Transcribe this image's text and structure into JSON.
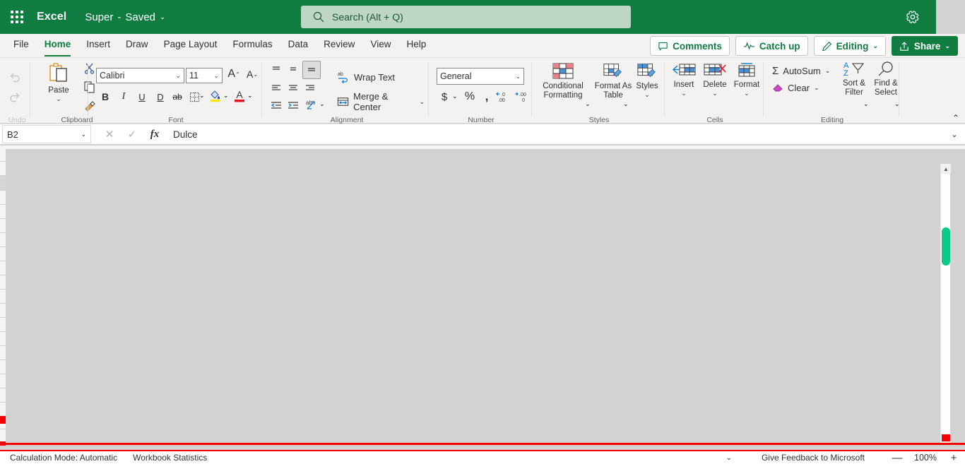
{
  "titlebar": {
    "waffle_label": "App launcher",
    "app_name": "Excel",
    "doc_title": "Super",
    "doc_sep": "-",
    "doc_state": "Saved",
    "chevron": "⌄",
    "gear_icon": "gear-icon"
  },
  "search": {
    "placeholder": "Search (Alt + Q)",
    "value": "",
    "icon": "search-icon"
  },
  "tabs": [
    {
      "label": "File",
      "active": false
    },
    {
      "label": "Home",
      "active": true
    },
    {
      "label": "Insert",
      "active": false
    },
    {
      "label": "Draw",
      "active": false
    },
    {
      "label": "Page Layout",
      "active": false
    },
    {
      "label": "Formulas",
      "active": false
    },
    {
      "label": "Data",
      "active": false
    },
    {
      "label": "Review",
      "active": false
    },
    {
      "label": "View",
      "active": false
    },
    {
      "label": "Help",
      "active": false
    }
  ],
  "tab_actions": {
    "comments": "Comments",
    "catch_up": "Catch up",
    "editing": "Editing",
    "editing_chevron": "⌄",
    "share": "Share",
    "share_chevron": "⌄"
  },
  "ribbon": {
    "collapse_chevron": "⌃",
    "groups": {
      "undo": {
        "name": "Undo",
        "undo_label": "Undo",
        "redo_label": "Redo"
      },
      "clipboard": {
        "name": "Clipboard",
        "paste_label": "Paste",
        "paste_chevron": "⌄",
        "cut_label": "Cut",
        "copy_label": "Copy",
        "format_painter_label": "Format Painter"
      },
      "font": {
        "name": "Font",
        "font_family_value": "Calibri",
        "font_size_value": "11",
        "dropdown_chevron": "⌄",
        "grow_font": "A",
        "shrink_font": "A",
        "bold": "B",
        "italic": "I",
        "underline": "U",
        "double_underline": "D",
        "strikethrough": "ab",
        "borders": "Borders",
        "fill_color": "Fill Color",
        "font_color": "Font Color"
      },
      "alignment": {
        "name": "Alignment",
        "wrap_text": "Wrap Text",
        "merge_center": "Merge & Center",
        "merge_chevron": "⌄",
        "align_top": "Top Align",
        "align_middle": "Middle Align",
        "align_bottom": "Bottom Align",
        "align_left": "Align Left",
        "align_center": "Center",
        "align_right": "Align Right",
        "decrease_indent": "Decrease Indent",
        "increase_indent": "Increase Indent",
        "orientation": "Orientation"
      },
      "number": {
        "name": "Number",
        "format_value": "General",
        "format_chevron": "⌄",
        "currency": "$",
        "currency_chevron": "⌄",
        "percent": "%",
        "comma": "comma-style",
        "increase_decimal": "Increase Decimal",
        "decrease_decimal": "Decrease Decimal"
      },
      "styles": {
        "name": "Styles",
        "conditional_formatting_line1": "Conditional",
        "conditional_formatting_line2": "Formatting",
        "conditional_chevron": "⌄",
        "format_as_table_line1": "Format As",
        "format_as_table_line2": "Table",
        "format_table_chevron": "⌄",
        "styles_label": "Styles",
        "styles_chevron": "⌄"
      },
      "cells": {
        "name": "Cells",
        "insert_label": "Insert",
        "insert_chevron": "⌄",
        "delete_label": "Delete",
        "delete_chevron": "⌄",
        "format_label": "Format",
        "format_chevron": "⌄"
      },
      "editing": {
        "name": "Editing",
        "autosum_label": "AutoSum",
        "autosum_chevron": "⌄",
        "clear_label": "Clear",
        "clear_chevron": "⌄",
        "sort_filter_line1": "Sort &",
        "sort_filter_line2": "Filter",
        "sort_chevron": "⌄",
        "find_select_line1": "Find &",
        "find_select_line2": "Select",
        "find_chevron": "⌄"
      }
    }
  },
  "formula_bar": {
    "name_box_value": "B2",
    "name_box_chevron": "⌄",
    "cancel_icon": "✕",
    "confirm_icon": "✓",
    "fx_icon": "fx",
    "formula_value": "Dulce",
    "expand_chevron": "⌄"
  },
  "statusbar": {
    "calculation_mode": "Calculation Mode: Automatic",
    "workbook_statistics": "Workbook Statistics",
    "options_chevron": "⌄",
    "feedback": "Give Feedback to Microsoft",
    "zoom_out": "—",
    "zoom_level": "100%",
    "zoom_in": "+"
  },
  "colors": {
    "brand_green": "#107c41",
    "search_bg": "#bdd6c6",
    "ribbon_bg": "#f3f2f1",
    "grid_bg": "#d2d2d2",
    "scroll_thumb": "#0bc987",
    "accent_red": "#f60000"
  }
}
